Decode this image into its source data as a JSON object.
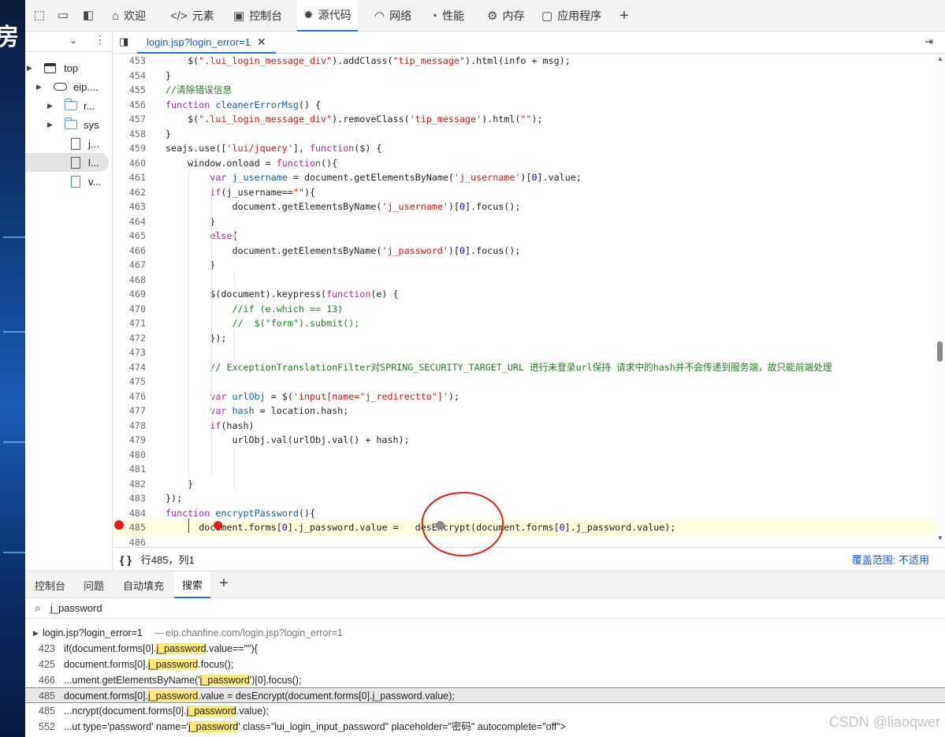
{
  "colors": {
    "accent": "#1a73e8",
    "breakpoint": "#e41e1e",
    "highlight": "#fbe97a"
  },
  "toolbar": {
    "tabs": [
      {
        "label": "欢迎",
        "icon": "home-icon"
      },
      {
        "label": "元素",
        "icon": "code-icon"
      },
      {
        "label": "控制台",
        "icon": "console-icon"
      },
      {
        "label": "源代码",
        "icon": "bug-icon"
      },
      {
        "label": "网络",
        "icon": "wifi-icon"
      },
      {
        "label": "性能",
        "icon": "gauge-icon"
      },
      {
        "label": "内存",
        "icon": "memory-icon"
      },
      {
        "label": "应用程序",
        "icon": "app-icon"
      }
    ],
    "active_tab": "源代码"
  },
  "navigator": {
    "items": [
      {
        "label": "top",
        "type": "window"
      },
      {
        "label": "eip....",
        "type": "cloud"
      },
      {
        "label": "r...",
        "type": "folder"
      },
      {
        "label": "sys",
        "type": "folder"
      },
      {
        "label": "j...",
        "type": "file"
      },
      {
        "label": "l...",
        "type": "file"
      },
      {
        "label": "v...",
        "type": "file"
      }
    ]
  },
  "editor": {
    "file_tab": "login.jsp?login_error=1",
    "lines": [
      {
        "n": "453",
        "html": "    $(<span class='st'>\".lui_login_message_div\"</span>).addClass(<span class='st'>\"tip_message\"</span>).html(info + msg);"
      },
      {
        "n": "454",
        "html": "}"
      },
      {
        "n": "455",
        "html": "<span class='cm'>//清除错误信息</span>"
      },
      {
        "n": "456",
        "html": "<span class='kw'>function</span> <span class='vr'>cleanerErrorMsg</span>() {"
      },
      {
        "n": "457",
        "html": "    $(<span class='st'>\".lui_login_message_div\"</span>).removeClass(<span class='st'>'tip_message'</span>).html(<span class='st'>\"\"</span>);"
      },
      {
        "n": "458",
        "html": "}"
      },
      {
        "n": "459",
        "html": "seajs.use([<span class='st'>'lui/jquery'</span>], <span class='kw'>function</span>($) {"
      },
      {
        "n": "460",
        "html": "    window.onload = <span class='kw'>function</span>(){"
      },
      {
        "n": "461",
        "html": "        <span class='kw'>var</span> <span class='vr'>j_username</span> = document.getElementsByName(<span class='st'>'j_username'</span>)[<span class='nm'>0</span>].value;"
      },
      {
        "n": "462",
        "html": "        <span class='kw'>if</span>(j_username==<span class='st'>\"\"</span>){"
      },
      {
        "n": "463",
        "html": "            document.getElementsByName(<span class='st'>'j_username'</span>)[<span class='nm'>0</span>].focus();"
      },
      {
        "n": "464",
        "html": "        }"
      },
      {
        "n": "465",
        "html": "        <span class='kw'>else</span>{"
      },
      {
        "n": "466",
        "html": "            document.getElementsByName(<span class='st'>'j_password'</span>)[<span class='nm'>0</span>].focus();"
      },
      {
        "n": "467",
        "html": "        }"
      },
      {
        "n": "468",
        "html": ""
      },
      {
        "n": "469",
        "html": "        $(document).keypress(<span class='kw'>function</span>(e) {"
      },
      {
        "n": "470",
        "html": "            <span class='cm'>//if (e.which == 13)</span>"
      },
      {
        "n": "471",
        "html": "            <span class='cm'>//  $(\"form\").submit();</span>"
      },
      {
        "n": "472",
        "html": "        });"
      },
      {
        "n": "473",
        "html": ""
      },
      {
        "n": "474",
        "html": "        <span class='cm'>// ExceptionTranslationFilter对SPRING_SECURITY_TARGET_URL 进行未登录url保持 请求中的hash并不会传递到服务端，故只能前端处理</span>"
      },
      {
        "n": "475",
        "html": ""
      },
      {
        "n": "476",
        "html": "        <span class='kw'>var</span> <span class='vr'>urlObj</span> = $(<span class='st'>'input[name=\"j_redirectto\"]'</span>);"
      },
      {
        "n": "477",
        "html": "        <span class='kw'>var</span> <span class='vr'>hash</span> = location.hash;"
      },
      {
        "n": "478",
        "html": "        <span class='kw'>if</span>(hash)"
      },
      {
        "n": "479",
        "html": "            urlObj.val(urlObj.val() + hash);"
      },
      {
        "n": "480",
        "html": ""
      },
      {
        "n": "481",
        "html": ""
      },
      {
        "n": "482",
        "html": "    }"
      },
      {
        "n": "483",
        "html": "});"
      },
      {
        "n": "484",
        "html": "<span class='kw'>function</span> <span class='vr'>encryptPassword</span>(){"
      },
      {
        "n": "485",
        "html": "      document.forms[<span class='nm'>0</span>].j_password.value =   desEncrypt(document.forms[<span class='nm'>0</span>].j_password.value);"
      },
      {
        "n": "486",
        "html": ""
      }
    ],
    "status": {
      "braces": "{ }",
      "position": "行485，列1",
      "coverage": "覆盖范围: 不适用"
    }
  },
  "drawer": {
    "tabs": [
      "控制台",
      "问题",
      "自动填充",
      "搜索"
    ],
    "active_tab": "搜索",
    "search_query": "j_password",
    "file_result": {
      "name": "login.jsp?login_error=1",
      "url": "eip.chanfine.com/login.jsp?login_error=1"
    },
    "results": [
      {
        "n": "423",
        "pre": "if(document.forms[0].",
        "match": "j_password",
        "post": ".value==\"\"){"
      },
      {
        "n": "425",
        "pre": "document.forms[0].",
        "match": "j_password",
        "post": ".focus();"
      },
      {
        "n": "466",
        "pre": "...ument.getElementsByName('",
        "match": "j_password",
        "post": "')[0].focus();"
      },
      {
        "n": "485",
        "pre": "document.forms[0].",
        "match": "j_password",
        "post": ".value = desEncrypt(document.forms[0].j_password.value);"
      },
      {
        "n": "485",
        "pre": "...ncrypt(document.forms[0].",
        "match": "j_password",
        "post": ".value);"
      },
      {
        "n": "552",
        "pre": "...ut type='password' name='",
        "match": "j_password",
        "post": "' class=\"lui_login_input_password\" placeholder=\"密码\" autocomplete=\"off\">"
      }
    ]
  },
  "watermark": "CSDN @liaoqwer",
  "left_glyph": "房"
}
